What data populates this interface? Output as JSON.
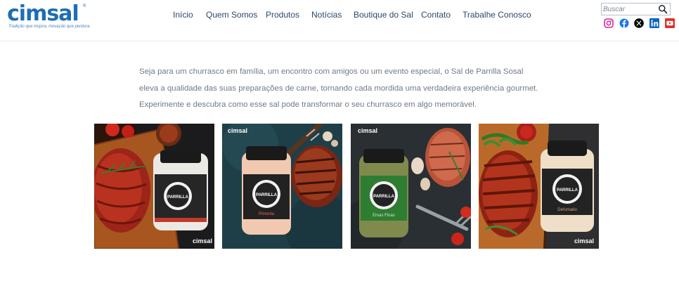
{
  "header": {
    "logo": {
      "word": "cimsal",
      "registered": "®",
      "tagline": "Tradição que inspira, inovação que perdura."
    },
    "nav": [
      {
        "label": "Início"
      },
      {
        "label": "Quem Somos"
      },
      {
        "label": "Produtos"
      },
      {
        "label": "Notícias"
      },
      {
        "label": "Boutique do Sal"
      },
      {
        "label": "Contato"
      },
      {
        "label": "Trabalhe Conosco"
      }
    ],
    "search": {
      "placeholder": "Buscar",
      "icon": "search-icon"
    },
    "social": [
      {
        "name": "instagram",
        "icon": "instagram-icon",
        "color": "#d6249f"
      },
      {
        "name": "facebook",
        "icon": "facebook-icon",
        "color": "#1877f2"
      },
      {
        "name": "x",
        "icon": "x-icon",
        "color": "#000000"
      },
      {
        "name": "linkedin",
        "icon": "linkedin-icon",
        "color": "#0a66c2"
      },
      {
        "name": "youtube",
        "icon": "youtube-icon",
        "color": "#ff0000"
      }
    ]
  },
  "main": {
    "intro": "Seja para um churrasco em família, um encontro com amigos ou um evento especial, o Sal de Parrilla Sosal eleva a qualidade das suas preparações de carne, tornando cada mordida uma verdadeira experiência gourmet. Experimente e descubra como esse sal pode transformar o seu churrasco em algo memorável.",
    "gallery": [
      {
        "brand": "cimsal",
        "jar_label": "PARRILLA",
        "variant": "",
        "accent": "#c0392b",
        "background": "#3b1e12"
      },
      {
        "brand": "cimsal",
        "jar_label": "PARRILLA",
        "variant": "Pimenta",
        "accent": "#d9534f",
        "background": "#1f3f48"
      },
      {
        "brand": "cimsal",
        "jar_label": "PARRILLA",
        "variant": "Ervas Finas",
        "accent": "#2e7d32",
        "background": "#2a2f33"
      },
      {
        "brand": "cimsal",
        "jar_label": "PARRILLA",
        "variant": "Defumado",
        "accent": "#b03a2e",
        "background": "#3a2418"
      }
    ]
  },
  "colors": {
    "brand": "#1e6db4",
    "nav": "#2b4968",
    "body_text": "#6f7a86"
  }
}
